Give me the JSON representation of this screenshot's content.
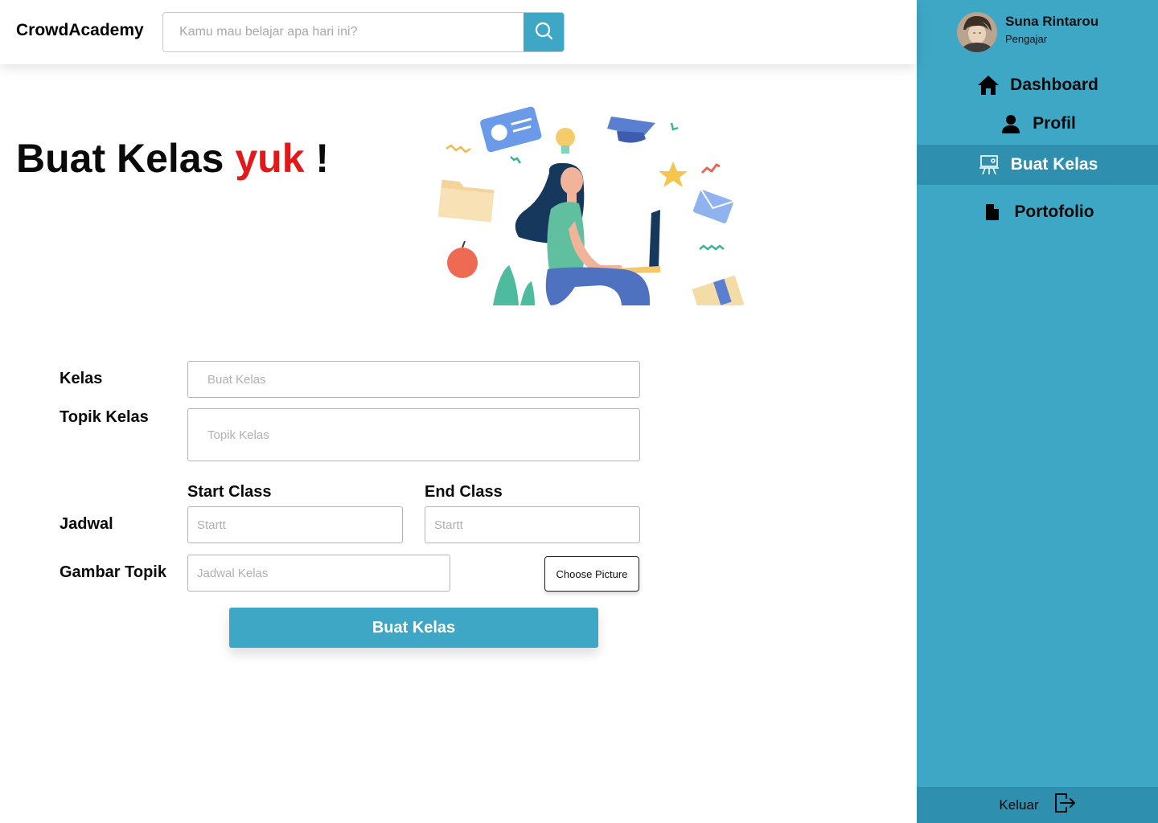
{
  "header": {
    "brand": "CrowdAcademy",
    "search_placeholder": "Kamu mau belajar apa hari ini?",
    "search_icon": "search-icon"
  },
  "sidebar": {
    "user": {
      "name": "Suna Rintarou",
      "role": "Pengajar"
    },
    "items": [
      {
        "label": "Dashboard",
        "icon": "home-icon",
        "active": false
      },
      {
        "label": "Profil",
        "icon": "user-icon",
        "active": false
      },
      {
        "label": "Buat Kelas",
        "icon": "presentation-board-icon",
        "active": true
      },
      {
        "label": "Portofolio",
        "icon": "document-icon",
        "active": false
      }
    ],
    "logout": {
      "label": "Keluar",
      "icon": "logout-icon"
    }
  },
  "hero": {
    "title_prefix": "Buat Kelas",
    "title_accent": "yuk",
    "title_suffix": "!"
  },
  "form": {
    "kelas": {
      "label": "Kelas",
      "placeholder": "Buat Kelas"
    },
    "topik": {
      "label": "Topik Kelas",
      "placeholder": "Topik Kelas"
    },
    "jadwal": {
      "label": "Jadwal",
      "start_label": "Start Class",
      "start_placeholder": "Startt",
      "end_label": "End Class",
      "end_placeholder": "Startt"
    },
    "gambar": {
      "label": "Gambar Topik",
      "placeholder": "Jadwal Kelas",
      "button": "Choose Picture"
    },
    "submit": "Buat Kelas"
  },
  "colors": {
    "primary": "#3fa7c6",
    "primary_dark": "#2e8fae",
    "accent_red": "#e11919"
  }
}
